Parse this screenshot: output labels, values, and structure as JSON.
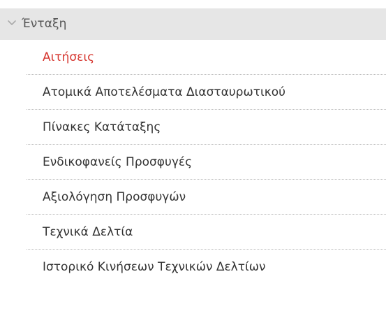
{
  "menu": {
    "header": {
      "label": "Ένταξη",
      "icon": "chevron-down-icon",
      "expanded": true
    },
    "items": [
      {
        "label": "Αιτήσεις",
        "active": true
      },
      {
        "label": "Ατομικά Αποτελέσματα Διασταυρωτικού",
        "active": false
      },
      {
        "label": "Πίνακες Κατάταξης",
        "active": false
      },
      {
        "label": "Ενδικοφανείς Προσφυγές",
        "active": false
      },
      {
        "label": "Αξιολόγηση Προσφυγών",
        "active": false
      },
      {
        "label": "Τεχνικά Δελτία",
        "active": false
      },
      {
        "label": "Ιστορικό Κινήσεων Τεχνικών Δελτίων",
        "active": false
      }
    ]
  },
  "colors": {
    "header_bg": "#e6e6e6",
    "active_text": "#d6362f",
    "text": "#333333",
    "divider": "#b9b9b9"
  }
}
